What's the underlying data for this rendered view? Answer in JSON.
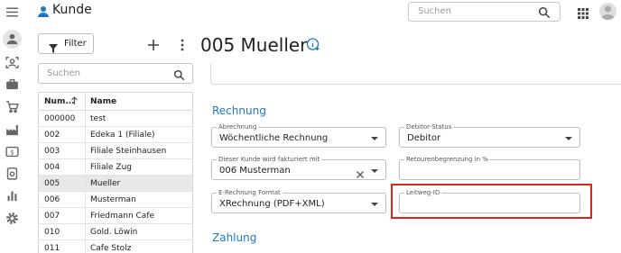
{
  "app": {
    "title": "Kunde",
    "search_placeholder": "Suchen",
    "accent_color": "#1e78c8",
    "rail_icons": [
      "menu-icon",
      "user-icon",
      "face-scan-icon",
      "briefcase-icon",
      "cart-icon",
      "factory-icon",
      "money-icon",
      "clipboard-clock-icon",
      "bar-chart-icon",
      "settings-icon"
    ]
  },
  "list": {
    "filter_label": "Filter",
    "search_placeholder": "Suchen",
    "columns": [
      "Num...",
      "Name"
    ],
    "rows": [
      {
        "num": "000000",
        "name": "test"
      },
      {
        "num": "002",
        "name": "Edeka 1 (Filiale)"
      },
      {
        "num": "003",
        "name": "Filiale Steinhausen"
      },
      {
        "num": "004",
        "name": "Filiale Zug"
      },
      {
        "num": "005",
        "name": "Mueller"
      },
      {
        "num": "006",
        "name": "Musterman"
      },
      {
        "num": "007",
        "name": "Friedmann Cafe"
      },
      {
        "num": "010",
        "name": "Gold. Löwin"
      },
      {
        "num": "011",
        "name": "Cafe Stolz"
      }
    ],
    "selected_num": "005"
  },
  "record": {
    "title": "005 Mueller"
  },
  "rechnung": {
    "heading": "Rechnung",
    "abrechnung": {
      "label": "Abrechnung",
      "value": "Wöchentliche Rechnung"
    },
    "debitor_status": {
      "label": "Debitor-Status",
      "value": "Debitor"
    },
    "fakturiert": {
      "label": "Dieser Kunde wird fakturiert mit",
      "value": "006 Musterman"
    },
    "retouren": {
      "label": "Retourenbegrenzung in %",
      "value": ""
    },
    "e_rechnung": {
      "label": "E-Rechnung Format",
      "value": "XRechnung (PDF+XML)"
    },
    "leitweg": {
      "label": "Leitweg-ID",
      "value": ""
    }
  },
  "zahlung": {
    "heading": "Zahlung"
  },
  "highlight_color": "#e0231c"
}
